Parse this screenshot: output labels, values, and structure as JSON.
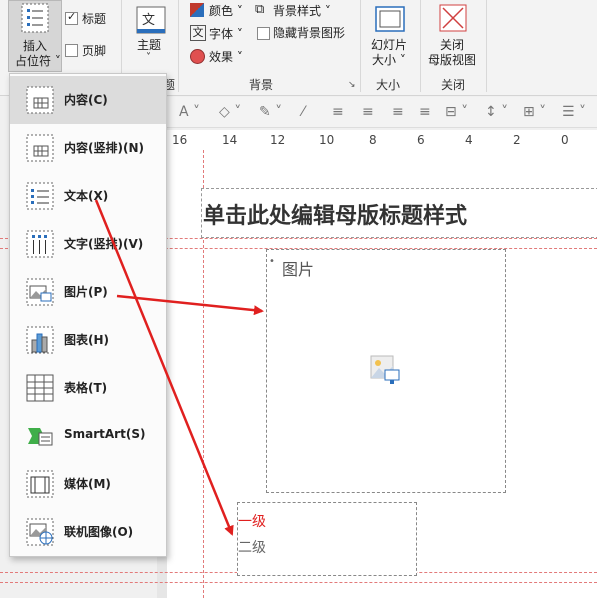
{
  "ribbon": {
    "insert_placeholder_label_1": "插入",
    "insert_placeholder_label_2": "占位符",
    "checkbox_title": "标题",
    "checkbox_footer": "页脚",
    "theme_label": "主题",
    "theme_group_suffix": "题",
    "colors_label": "颜色",
    "fonts_label": "字体",
    "effects_label": "效果",
    "background_styles_label": "背景样式",
    "hide_background_label": "隐藏背景图形",
    "background_group_label": "背景",
    "slide_size_label_1": "幻灯片",
    "slide_size_label_2": "大小",
    "size_group_label": "大小",
    "close_master_label_1": "关闭",
    "close_master_label_2": "母版视图",
    "close_group_label": "关闭"
  },
  "ruler": {
    "ticks": [
      "16",
      "14",
      "12",
      "10",
      "8",
      "6",
      "4",
      "2",
      "0"
    ]
  },
  "menu": {
    "items": [
      {
        "label": "内容(C)",
        "icon": "content-layout-icon"
      },
      {
        "label": "内容(竖排)(N)",
        "icon": "vertical-content-layout-icon"
      },
      {
        "label": "文本(X)",
        "icon": "text-list-icon"
      },
      {
        "label": "文字(竖排)(V)",
        "icon": "vertical-text-icon"
      },
      {
        "label": "图片(P)",
        "icon": "picture-icon"
      },
      {
        "label": "图表(H)",
        "icon": "chart-icon"
      },
      {
        "label": "表格(T)",
        "icon": "table-icon"
      },
      {
        "label": "SmartArt(S)",
        "icon": "smartart-icon"
      },
      {
        "label": "媒体(M)",
        "icon": "media-icon"
      },
      {
        "label": "联机图像(O)",
        "icon": "online-picture-icon"
      }
    ]
  },
  "slide": {
    "title": "单击此处编辑母版标题样式",
    "picture_placeholder": "图片",
    "level1": "一级",
    "level2": "二级"
  },
  "colors": {
    "accent_red": "#e0201f",
    "dashed_guide": "#e27a7a"
  }
}
